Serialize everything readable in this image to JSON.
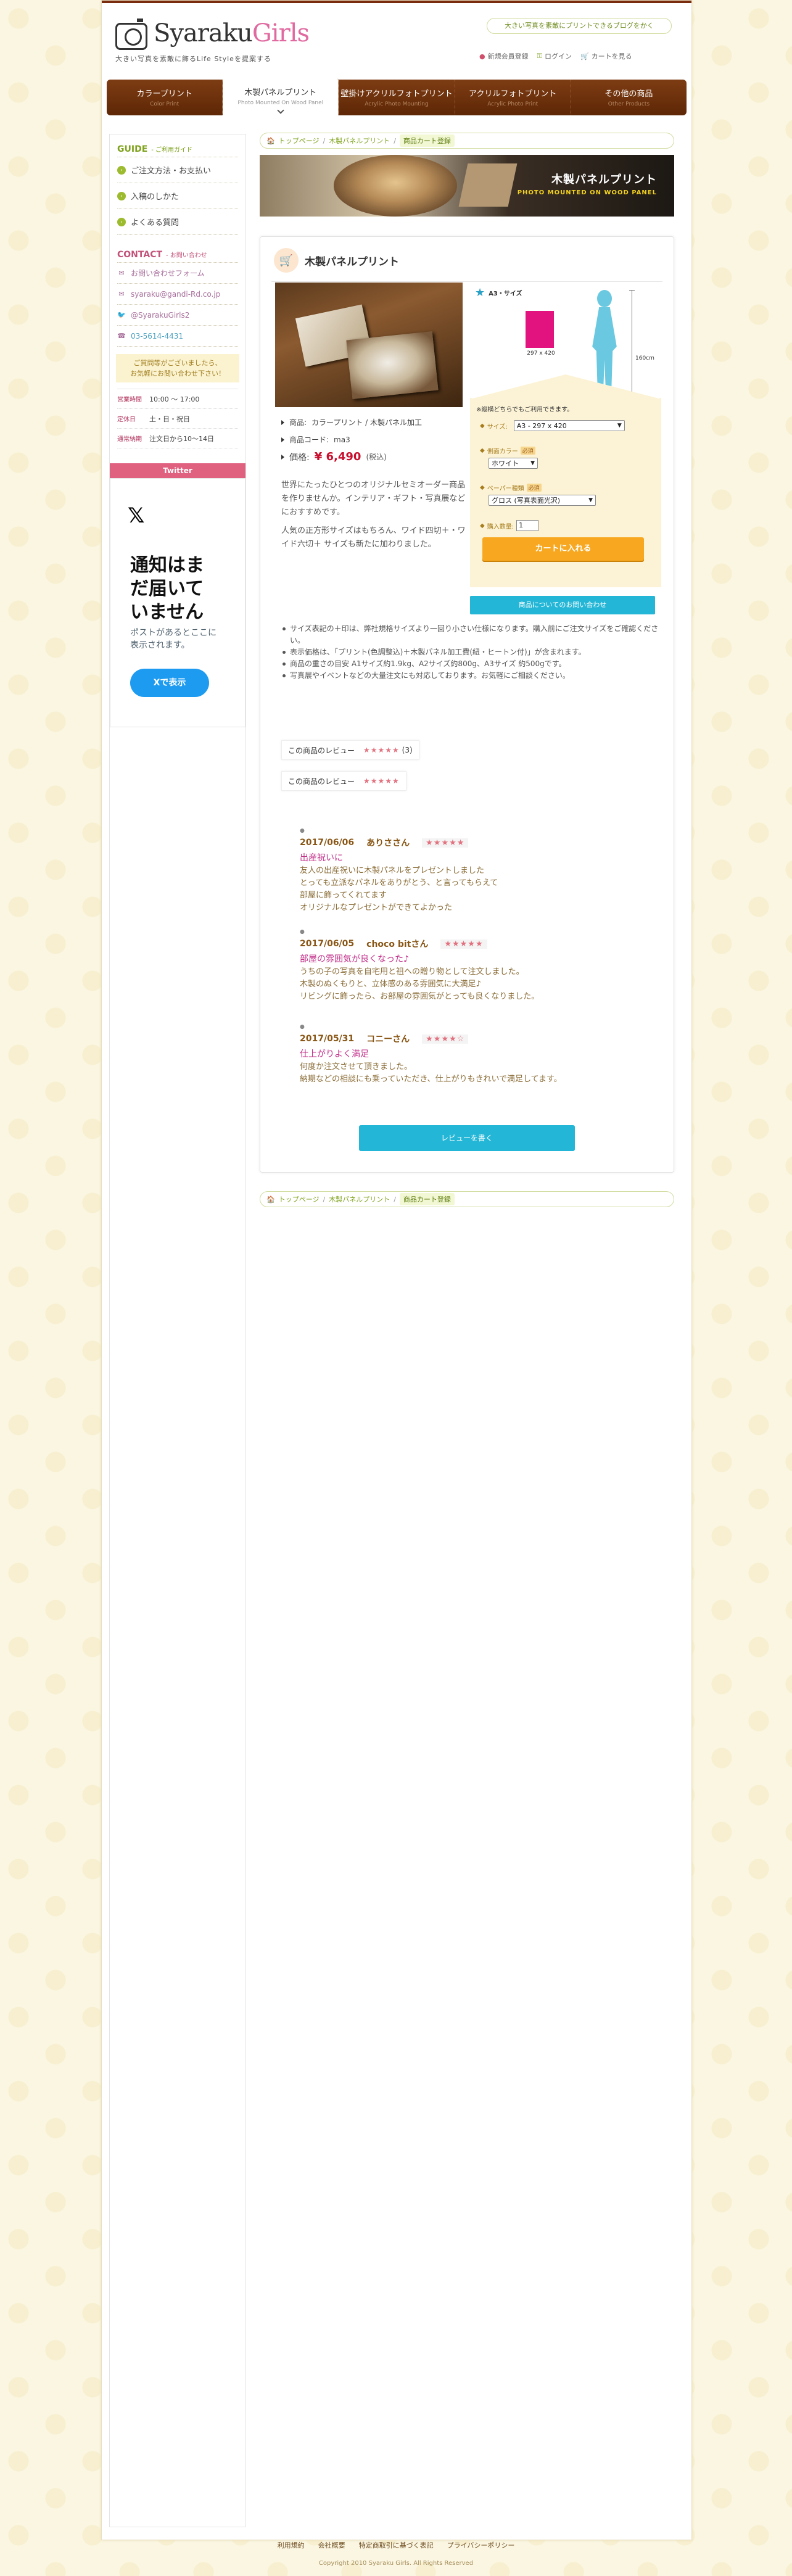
{
  "header": {
    "logo_main": "Syaraku",
    "logo_accent": "Girls",
    "logo_sub": "大きい写真を素敵に飾るLife Styleを提案する",
    "blog_link": "大きい写真を素敵にプリントできるブログをかく",
    "nav": [
      {
        "icon": "user-icon",
        "label": "新規会員登録"
      },
      {
        "icon": "key-icon",
        "label": "ログイン"
      },
      {
        "icon": "cart-icon",
        "label": "カートを見る"
      }
    ]
  },
  "gnav": [
    {
      "ja": "カラープリント",
      "en": "Color Print"
    },
    {
      "ja": "木製パネルプリント",
      "en": "Photo Mounted On Wood Panel"
    },
    {
      "ja": "壁掛けアクリルフォトプリント",
      "en": "Acrylic Photo Mounting"
    },
    {
      "ja": "アクリルフォトプリント",
      "en": "Acrylic Photo Print"
    },
    {
      "ja": "その他の商品",
      "en": "Other Products"
    }
  ],
  "sidebar": {
    "guide_title": "GUIDE",
    "guide_sub": "- ご利用ガイド",
    "guide_items": [
      "ご注文方法・お支払い",
      "入稿のしかた",
      "よくある質問"
    ],
    "contact_title": "CONTACT",
    "contact_sub": "- お問い合わせ",
    "contact_items": [
      {
        "icon": "mail-icon",
        "label": "お問い合わせフォーム"
      },
      {
        "icon": "at-icon",
        "label": "syaraku@gandi-Rd.co.jp"
      },
      {
        "icon": "twitter-icon",
        "label": "@SyarakuGirls2"
      },
      {
        "icon": "phone-icon",
        "label": "03-5614-4431"
      }
    ],
    "note": "ご質問等がございましたら、\nお気軽にお問い合わせ下さい！",
    "hours": [
      {
        "k": "営業時間",
        "v": "10:00 〜 17:00"
      },
      {
        "k": "定休日",
        "v": "土・日・祝日"
      },
      {
        "k": "通常納期",
        "v": "注文日から10〜14日"
      }
    ],
    "twitter_head": "Twitter",
    "twitter_x": "𝕏",
    "twitter_h": "通知はま\nだ届いて\nいません",
    "twitter_p": "ポストがあるとここに\n表示されます。",
    "twitter_btn": "Xで表示"
  },
  "breadcrumb": {
    "home": "トップページ",
    "category": "木製パネルプリント",
    "current": "商品カート登録"
  },
  "banner": {
    "title": "木製パネルプリント",
    "sub": "PHOTO MOUNTED ON WOOD PANEL"
  },
  "product": {
    "title": "木製パネルプリント",
    "product_label": "商品: ",
    "product_value": "カラープリント / 木製パネル加工",
    "code_label": "商品コード: ",
    "code_value": "ma3",
    "price_label": "価格: ",
    "price_value": "¥ 6,490",
    "price_tax": "(税込)",
    "desc1": "世界にたったひとつのオリジナルセミオーダー商品を作りませんか。インテリア・ギフト・写真展などにおすすめです。",
    "desc2": "人気の正方形サイズはもちろん、ワイド四切＋・ワイド六切＋ サイズも新たに加わりました。"
  },
  "size_graphic": {
    "label": "A3・サイズ",
    "panel_dim": "297 x 420",
    "height_label": "160cm"
  },
  "form": {
    "note": "※縦横どちらでもご利用できます。",
    "size_label": "サイズ:",
    "size_value": "A3 - 297 x 420",
    "frame_label": "側面カラー",
    "frame_value": "ホワイト",
    "paper_label": "ペーパー種類",
    "paper_value": "グロス (写真表面光沢)",
    "qty_label": "購入数量:",
    "qty_value": "1",
    "required": "必須",
    "add_to_cart": "カートに入れる",
    "inquiry": "商品についてのお問い合わせ"
  },
  "notes": [
    "サイズ表記の＋印は、弊社規格サイズより一回り小さい仕様になります。購入前にご注文サイズをご確認ください。",
    "表示価格は、「プリント(色調整込)＋木製パネル加工費(紐・ヒートン付)」が含まれます。",
    "商品の重さの目安 A1サイズ約1.9kg、A2サイズ約800g、A3サイズ 約500gです。",
    "写真展やイベントなどの大量注文にも対応しております。お気軽にご相談ください。"
  ],
  "review_summary": [
    {
      "label": "この商品のレビュー",
      "stars": "★★★★★",
      "count": "(3)"
    },
    {
      "label": "この商品のレビュー",
      "stars": "★★★★★",
      "count": ""
    }
  ],
  "reviews": [
    {
      "date": "2017/06/06",
      "name": "ありささん",
      "stars": "★★★★★",
      "title": "出産祝いに",
      "body": "友人の出産祝いに木製パネルをプレゼントしました\nとっても立派なパネルをありがとう、と言ってもらえて\n部屋に飾ってくれてます\nオリジナルなプレゼントができてよかった"
    },
    {
      "date": "2017/06/05",
      "name": "choco bitさん",
      "stars": "★★★★★",
      "title": "部屋の雰囲気が良くなった♪",
      "body": "うちの子の写真を自宅用と祖への贈り物として注文しました。\n木製のぬくもりと、立体感のある雰囲気に大満足♪\nリビングに飾ったら、お部屋の雰囲気がとっても良くなりました。"
    },
    {
      "date": "2017/05/31",
      "name": "コニーさん",
      "stars": "★★★★☆",
      "title": "仕上がりよく満足",
      "body": "何度か注文させて頂きました。\n納期などの相談にも乗っていただき、仕上がりもきれいで満足してます。"
    }
  ],
  "more_reviews": "レビューを書く",
  "footer": {
    "links": [
      "利用規約",
      "会社概要",
      "特定商取引に基づく表記",
      "プライバシーポリシー"
    ],
    "copyright": "Copyright 2010 Syaraku Girls. All Rights Reserved"
  }
}
